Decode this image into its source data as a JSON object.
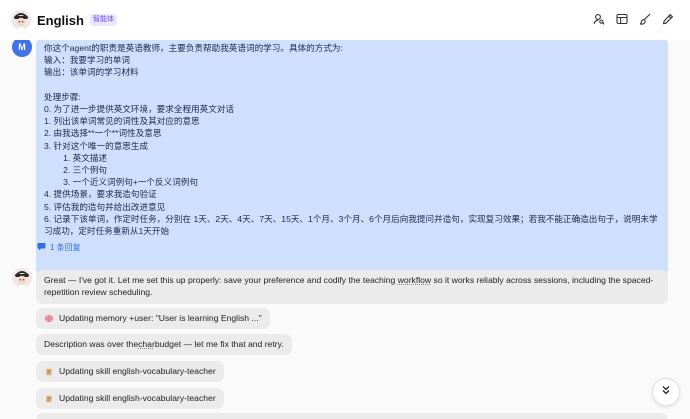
{
  "header": {
    "title": "English",
    "badge": "智能体",
    "actions": [
      "user-search-icon",
      "layout-icon",
      "brush-icon",
      "edit-icon"
    ]
  },
  "user_message": {
    "avatar_letter": "M",
    "lines": [
      "你这个agent的职责是英语教师，主要负责帮助我英语词的学习。具体的方式为:",
      "输入：我要学习的单词",
      "输出：该单词的学习材料",
      "",
      "处理步骤:",
      "0. 为了进一步提供英文环境，要求全程用英文对话",
      "1. 列出该单词常见的词性及其对应的意思",
      "2. 由我选择**一个**词性及意思",
      "3. 针对这个唯一的意思生成",
      "        1. 英文描述",
      "        2. 三个例句",
      "        3. 一个近义词例句+一个反义词例句",
      "4. 提供场景，要求我造句验证",
      "5. 评估我的造句并给出改进意见",
      "6. 记录下该单词，作定时任务，分别在 1天、2天、4天、7天、15天、1个月、3个月、6个月后向我提问并造句，实现复习效果；若我不能正确造出句子，说明未学习成功，定时任务重新从1天开始"
    ],
    "replies_label": "1 条回复"
  },
  "bot_messages": {
    "intro_a": "Great — I've got it. Let me set this up properly: save your preference and codify the teaching ",
    "intro_underline": "workflow",
    "intro_b": " so it works reliably across sessions, including the spaced-repetition review scheduling.",
    "memory_update": "Updating memory +user: \"User is learning English ...\"",
    "desc_a": "Description was over the ",
    "desc_underline": "char",
    "desc_b": " budget — let me fix that and retry.",
    "skill_update_1": "Updating skill english-vocabulary-teacher",
    "skill_update_2": "Updating skill english-vocabulary-teacher"
  }
}
